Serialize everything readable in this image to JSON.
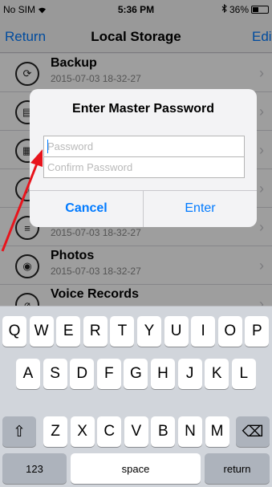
{
  "status_bar": {
    "carrier": "No SIM",
    "time": "5:36 PM",
    "battery": "36%",
    "battery_level": 0.36
  },
  "nav": {
    "back_label": "Return",
    "title": "Local Storage",
    "edit_label": "Edit"
  },
  "rows": [
    {
      "title": "Backup",
      "date": "2015-07-03 18-32-27",
      "icon": "backup-icon",
      "glyph": "⟳"
    },
    {
      "title": "",
      "date": "",
      "icon": "file-icon",
      "glyph": "▤"
    },
    {
      "title": "",
      "date": "",
      "icon": "film-icon",
      "glyph": "▦"
    },
    {
      "title": "",
      "date": "",
      "icon": "music-icon",
      "glyph": "♪"
    },
    {
      "title": "",
      "date": "2015-07-03 18-32-27",
      "icon": "stack-icon",
      "glyph": "≡"
    },
    {
      "title": "Photos",
      "date": "2015-07-03 18-32-27",
      "icon": "camera-icon",
      "glyph": "◉"
    },
    {
      "title": "Voice Records",
      "date": "",
      "icon": "microphone-icon",
      "glyph": "⌀"
    }
  ],
  "alert": {
    "title": "Enter Master Password",
    "password_placeholder": "Password",
    "password_value": "",
    "confirm_placeholder": "Confirm Password",
    "confirm_value": "",
    "cancel_label": "Cancel",
    "enter_label": "Enter"
  },
  "keyboard": {
    "row1": [
      "Q",
      "W",
      "E",
      "R",
      "T",
      "Y",
      "U",
      "I",
      "O",
      "P"
    ],
    "row2": [
      "A",
      "S",
      "D",
      "F",
      "G",
      "H",
      "J",
      "K",
      "L"
    ],
    "row3": [
      "Z",
      "X",
      "C",
      "V",
      "B",
      "N",
      "M"
    ],
    "shift_glyph": "⇧",
    "delete_glyph": "⌫",
    "numbers_label": "123",
    "space_label": "space",
    "return_label": "return"
  },
  "colors": {
    "accent": "#007aff",
    "annotation": "#e8141c"
  }
}
